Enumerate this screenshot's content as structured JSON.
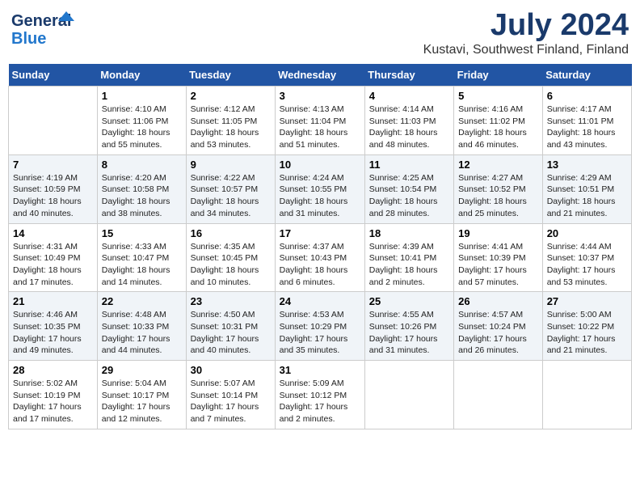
{
  "header": {
    "logo_line1": "General",
    "logo_line2": "Blue",
    "month": "July 2024",
    "location": "Kustavi, Southwest Finland, Finland"
  },
  "days_of_week": [
    "Sunday",
    "Monday",
    "Tuesday",
    "Wednesday",
    "Thursday",
    "Friday",
    "Saturday"
  ],
  "weeks": [
    [
      {
        "day": "",
        "info": ""
      },
      {
        "day": "1",
        "info": "Sunrise: 4:10 AM\nSunset: 11:06 PM\nDaylight: 18 hours\nand 55 minutes."
      },
      {
        "day": "2",
        "info": "Sunrise: 4:12 AM\nSunset: 11:05 PM\nDaylight: 18 hours\nand 53 minutes."
      },
      {
        "day": "3",
        "info": "Sunrise: 4:13 AM\nSunset: 11:04 PM\nDaylight: 18 hours\nand 51 minutes."
      },
      {
        "day": "4",
        "info": "Sunrise: 4:14 AM\nSunset: 11:03 PM\nDaylight: 18 hours\nand 48 minutes."
      },
      {
        "day": "5",
        "info": "Sunrise: 4:16 AM\nSunset: 11:02 PM\nDaylight: 18 hours\nand 46 minutes."
      },
      {
        "day": "6",
        "info": "Sunrise: 4:17 AM\nSunset: 11:01 PM\nDaylight: 18 hours\nand 43 minutes."
      }
    ],
    [
      {
        "day": "7",
        "info": "Sunrise: 4:19 AM\nSunset: 10:59 PM\nDaylight: 18 hours\nand 40 minutes."
      },
      {
        "day": "8",
        "info": "Sunrise: 4:20 AM\nSunset: 10:58 PM\nDaylight: 18 hours\nand 38 minutes."
      },
      {
        "day": "9",
        "info": "Sunrise: 4:22 AM\nSunset: 10:57 PM\nDaylight: 18 hours\nand 34 minutes."
      },
      {
        "day": "10",
        "info": "Sunrise: 4:24 AM\nSunset: 10:55 PM\nDaylight: 18 hours\nand 31 minutes."
      },
      {
        "day": "11",
        "info": "Sunrise: 4:25 AM\nSunset: 10:54 PM\nDaylight: 18 hours\nand 28 minutes."
      },
      {
        "day": "12",
        "info": "Sunrise: 4:27 AM\nSunset: 10:52 PM\nDaylight: 18 hours\nand 25 minutes."
      },
      {
        "day": "13",
        "info": "Sunrise: 4:29 AM\nSunset: 10:51 PM\nDaylight: 18 hours\nand 21 minutes."
      }
    ],
    [
      {
        "day": "14",
        "info": "Sunrise: 4:31 AM\nSunset: 10:49 PM\nDaylight: 18 hours\nand 17 minutes."
      },
      {
        "day": "15",
        "info": "Sunrise: 4:33 AM\nSunset: 10:47 PM\nDaylight: 18 hours\nand 14 minutes."
      },
      {
        "day": "16",
        "info": "Sunrise: 4:35 AM\nSunset: 10:45 PM\nDaylight: 18 hours\nand 10 minutes."
      },
      {
        "day": "17",
        "info": "Sunrise: 4:37 AM\nSunset: 10:43 PM\nDaylight: 18 hours\nand 6 minutes."
      },
      {
        "day": "18",
        "info": "Sunrise: 4:39 AM\nSunset: 10:41 PM\nDaylight: 18 hours\nand 2 minutes."
      },
      {
        "day": "19",
        "info": "Sunrise: 4:41 AM\nSunset: 10:39 PM\nDaylight: 17 hours\nand 57 minutes."
      },
      {
        "day": "20",
        "info": "Sunrise: 4:44 AM\nSunset: 10:37 PM\nDaylight: 17 hours\nand 53 minutes."
      }
    ],
    [
      {
        "day": "21",
        "info": "Sunrise: 4:46 AM\nSunset: 10:35 PM\nDaylight: 17 hours\nand 49 minutes."
      },
      {
        "day": "22",
        "info": "Sunrise: 4:48 AM\nSunset: 10:33 PM\nDaylight: 17 hours\nand 44 minutes."
      },
      {
        "day": "23",
        "info": "Sunrise: 4:50 AM\nSunset: 10:31 PM\nDaylight: 17 hours\nand 40 minutes."
      },
      {
        "day": "24",
        "info": "Sunrise: 4:53 AM\nSunset: 10:29 PM\nDaylight: 17 hours\nand 35 minutes."
      },
      {
        "day": "25",
        "info": "Sunrise: 4:55 AM\nSunset: 10:26 PM\nDaylight: 17 hours\nand 31 minutes."
      },
      {
        "day": "26",
        "info": "Sunrise: 4:57 AM\nSunset: 10:24 PM\nDaylight: 17 hours\nand 26 minutes."
      },
      {
        "day": "27",
        "info": "Sunrise: 5:00 AM\nSunset: 10:22 PM\nDaylight: 17 hours\nand 21 minutes."
      }
    ],
    [
      {
        "day": "28",
        "info": "Sunrise: 5:02 AM\nSunset: 10:19 PM\nDaylight: 17 hours\nand 17 minutes."
      },
      {
        "day": "29",
        "info": "Sunrise: 5:04 AM\nSunset: 10:17 PM\nDaylight: 17 hours\nand 12 minutes."
      },
      {
        "day": "30",
        "info": "Sunrise: 5:07 AM\nSunset: 10:14 PM\nDaylight: 17 hours\nand 7 minutes."
      },
      {
        "day": "31",
        "info": "Sunrise: 5:09 AM\nSunset: 10:12 PM\nDaylight: 17 hours\nand 2 minutes."
      },
      {
        "day": "",
        "info": ""
      },
      {
        "day": "",
        "info": ""
      },
      {
        "day": "",
        "info": ""
      }
    ]
  ]
}
